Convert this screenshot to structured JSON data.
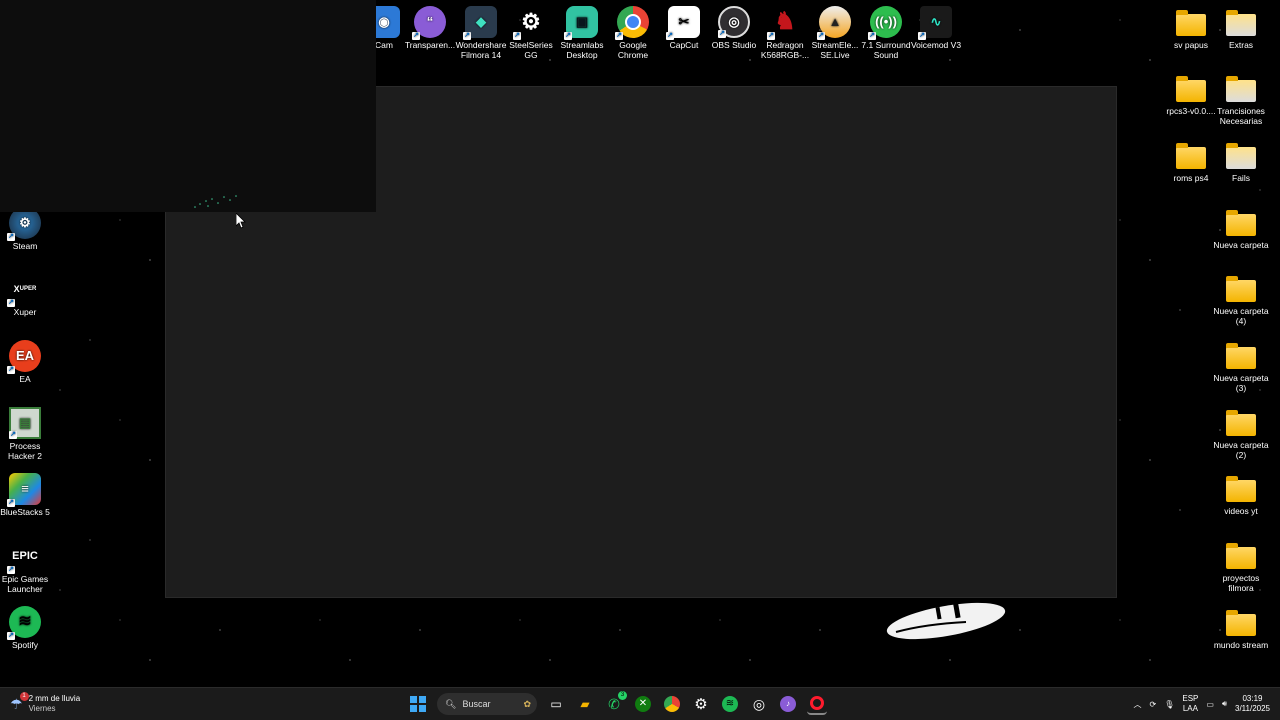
{
  "desktop": {
    "top_icons": [
      {
        "label": "Cam",
        "icon": "camera-app-icon",
        "color": "#2c79d6"
      },
      {
        "label": "Transparen...",
        "icon": "chat-bubble-icon",
        "color": "#8a5cd6"
      },
      {
        "label": "Wondershare Filmora 14",
        "icon": "filmora-icon",
        "color": "#2a3b4d"
      },
      {
        "label": "SteelSeries GG",
        "icon": "steelseries-icon",
        "color": "#1d1d1d"
      },
      {
        "label": "Streamlabs Desktop",
        "icon": "streamlabs-icon",
        "color": "#31c3a2"
      },
      {
        "label": "Google Chrome",
        "icon": "chrome-icon",
        "color": "#4285f4"
      },
      {
        "label": "CapCut",
        "icon": "capcut-icon",
        "color": "#ffffff"
      },
      {
        "label": "OBS Studio",
        "icon": "obs-icon",
        "color": "#302e31"
      },
      {
        "label": "Redragon K568RGB-...",
        "icon": "redragon-icon",
        "color": "#c4161c"
      },
      {
        "label": "StreamEle... SE.Live",
        "icon": "streamelements-icon",
        "color": "#f5a623"
      },
      {
        "label": "7.1 Surround Sound",
        "icon": "surround-sound-icon",
        "color": "#2dbd4e"
      },
      {
        "label": "Voicemod V3",
        "icon": "voicemod-icon",
        "color": "#1a1a1a"
      }
    ],
    "left_icons": [
      {
        "label": "Steam",
        "icon": "steam-icon",
        "color": "#1b2838"
      },
      {
        "label": "Xuper",
        "icon": "xuper-icon",
        "color": "#1a1a1a"
      },
      {
        "label": "EA",
        "icon": "ea-icon",
        "color": "#e83e1c"
      },
      {
        "label": "Process Hacker 2",
        "icon": "process-hacker-icon",
        "color": "#3a7d3a"
      },
      {
        "label": "BlueStacks 5",
        "icon": "bluestacks-icon",
        "color": "#47b04b"
      },
      {
        "label": "Epic Games Launcher",
        "icon": "epic-games-icon",
        "color": "#111111"
      },
      {
        "label": "Spotify",
        "icon": "spotify-icon",
        "color": "#1db954"
      }
    ],
    "right_icons": [
      {
        "label": "sv papus",
        "icon": "folder-icon"
      },
      {
        "label": "Extras",
        "icon": "folder-icon"
      },
      {
        "label": "rpcs3-v0.0....",
        "icon": "folder-icon"
      },
      {
        "label": "Trancisiones Necesarias",
        "icon": "folder-icon"
      },
      {
        "label": "roms ps4",
        "icon": "folder-icon"
      },
      {
        "label": "Fails",
        "icon": "folder-icon"
      },
      {
        "label": "Nueva carpeta",
        "icon": "folder-icon"
      },
      {
        "label": "Nueva carpeta (4)",
        "icon": "folder-icon"
      },
      {
        "label": "Nueva carpeta (3)",
        "icon": "folder-icon"
      },
      {
        "label": "Nueva carpeta (2)",
        "icon": "folder-icon"
      },
      {
        "label": "videos yt",
        "icon": "folder-icon"
      },
      {
        "label": "proyectos filmora",
        "icon": "folder-icon"
      },
      {
        "label": "mundo stream",
        "icon": "folder-icon"
      }
    ]
  },
  "taskbar": {
    "weather": {
      "temp_text": "2 mm de lluvia",
      "day": "Viernes",
      "badge": "1"
    },
    "search_placeholder": "Buscar",
    "pinned": [
      "windows-start-icon",
      "task-view-icon",
      "file-explorer-icon",
      "whatsapp-icon",
      "xbox-icon",
      "chrome-icon",
      "steelseries-icon",
      "spotify-icon",
      "obs-icon",
      "voicemod-icon",
      "opera-icon"
    ],
    "whatsapp_badge": "3",
    "language": {
      "line1": "ESP",
      "line2": "LAA"
    },
    "clock": {
      "time": "03:19",
      "date": "3/11/2025"
    }
  }
}
